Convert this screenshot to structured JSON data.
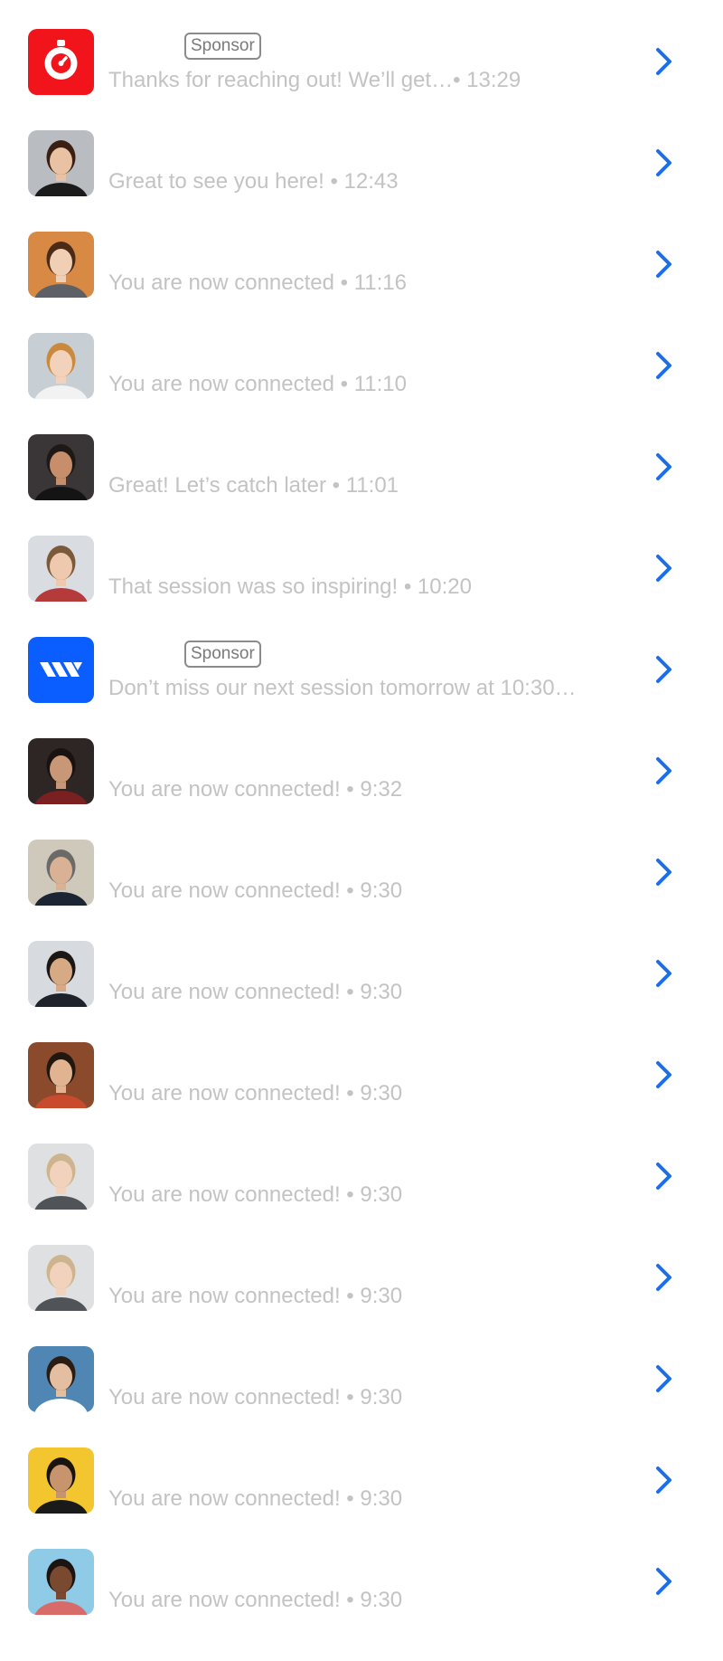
{
  "colors": {
    "accent": "#1a6fe6",
    "muted_text": "#c3c3c3",
    "badge_text": "#7a7a7a"
  },
  "conversations": [
    {
      "avatar": "stopwatch-logo-icon",
      "avatar_bg": "#f2141b",
      "sponsor": "Sponsor",
      "message": "Thanks for reaching out! We’ll get…• 13:29"
    },
    {
      "avatar": "person-avatar",
      "avatar_bg": "#b9bcc0",
      "sponsor": "",
      "message": "Great to see you here!  • 12:43"
    },
    {
      "avatar": "person-avatar",
      "avatar_bg": "#d88a45",
      "sponsor": "",
      "message": "You are now connected • 11:16"
    },
    {
      "avatar": "person-avatar",
      "avatar_bg": "#c7ced4",
      "sponsor": "",
      "message": "You are now connected • 11:10"
    },
    {
      "avatar": "person-avatar",
      "avatar_bg": "#3a3536",
      "sponsor": "",
      "message": "Great! Let’s catch later • 11:01"
    },
    {
      "avatar": "person-avatar",
      "avatar_bg": "#d9dde2",
      "sponsor": "",
      "message": "That session was so inspiring! • 10:20"
    },
    {
      "avatar": "stripes-logo-icon",
      "avatar_bg": "#0a5dff",
      "sponsor": "Sponsor",
      "message": "Don’t miss our next session tomorrow at 10:30…"
    },
    {
      "avatar": "person-avatar",
      "avatar_bg": "#2e2624",
      "sponsor": "",
      "message": "You are now connected! • 9:32"
    },
    {
      "avatar": "person-avatar",
      "avatar_bg": "#cfc9bb",
      "sponsor": "",
      "message": "You are now connected! • 9:30"
    },
    {
      "avatar": "person-avatar",
      "avatar_bg": "#d7dadf",
      "sponsor": "",
      "message": "You are now connected! • 9:30"
    },
    {
      "avatar": "person-avatar",
      "avatar_bg": "#8b4a2c",
      "sponsor": "",
      "message": "You are now connected! • 9:30"
    },
    {
      "avatar": "person-avatar",
      "avatar_bg": "#dfe0e2",
      "sponsor": "",
      "message": "You are now connected! • 9:30"
    },
    {
      "avatar": "person-avatar",
      "avatar_bg": "#dfe0e2",
      "sponsor": "",
      "message": "You are now connected! • 9:30"
    },
    {
      "avatar": "person-avatar",
      "avatar_bg": "#4f86b3",
      "sponsor": "",
      "message": "You are now connected! • 9:30"
    },
    {
      "avatar": "person-avatar",
      "avatar_bg": "#f3c62f",
      "sponsor": "",
      "message": "You are now connected! • 9:30"
    },
    {
      "avatar": "person-avatar",
      "avatar_bg": "#8fcbe6",
      "sponsor": "",
      "message": "You are now connected! • 9:30"
    }
  ]
}
